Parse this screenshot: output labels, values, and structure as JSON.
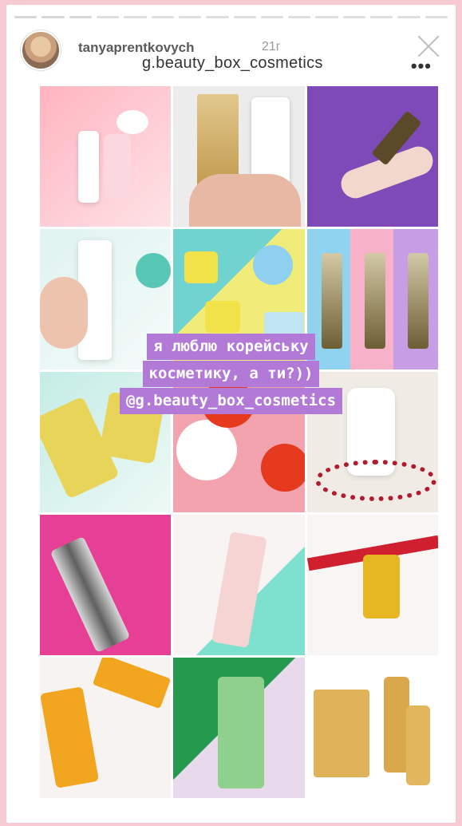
{
  "header": {
    "username": "tanyaprentkovych",
    "time": "21г",
    "title": "g.beauty_box_cosmetics",
    "more": "•••"
  },
  "overlay": {
    "lines": [
      "я люблю корейську",
      "косметику, а ти?))",
      "@g.beauty_box_cosmetics"
    ]
  },
  "footer": {
    "more": "•••"
  },
  "colors": {
    "background": "#f7c9d3",
    "highlight": "#b27ad6"
  },
  "icons": [
    "avatar",
    "close-icon",
    "more-icon",
    "send-icon"
  ]
}
